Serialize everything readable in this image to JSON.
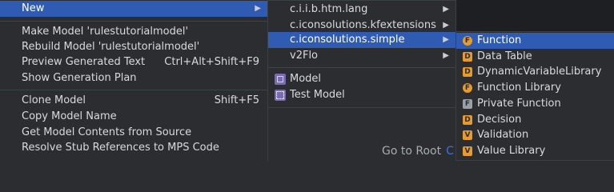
{
  "menu1": {
    "new_label": "New",
    "items": [
      {
        "label": "Make Model 'rulestutorialmodel'",
        "shortcut": ""
      },
      {
        "label": "Rebuild Model 'rulestutorialmodel'",
        "shortcut": ""
      },
      {
        "label": "Preview Generated Text",
        "shortcut": "Ctrl+Alt+Shift+F9"
      },
      {
        "label": "Show Generation Plan",
        "shortcut": ""
      },
      {
        "label": "Clone Model",
        "shortcut": "Shift+F5"
      },
      {
        "label": "Copy Model Name",
        "shortcut": ""
      },
      {
        "label": "Get Model Contents from Source",
        "shortcut": ""
      },
      {
        "label": "Resolve Stub References to MPS Code",
        "shortcut": ""
      }
    ]
  },
  "menu2": {
    "items": [
      {
        "label": "c.i.i.b.htm.lang"
      },
      {
        "label": "c.iconsolutions.kfextensions"
      },
      {
        "label": "c.iconsolutions.simple"
      },
      {
        "label": "v2Flo"
      },
      {
        "label": "Model",
        "icon": "model-icon"
      },
      {
        "label": "Test Model",
        "icon": "test-model-icon"
      }
    ]
  },
  "menu3": {
    "items": [
      {
        "label": "Function",
        "icon_letter": "F",
        "icon": "concept-function-icon"
      },
      {
        "label": "Data Table",
        "icon_letter": "D",
        "icon": "concept-data-table-icon"
      },
      {
        "label": "DynamicVariableLibrary",
        "icon_letter": "D",
        "icon": "concept-dynamic-variable-library-icon"
      },
      {
        "label": "Function Library",
        "icon_letter": "F",
        "icon": "concept-function-library-icon"
      },
      {
        "label": "Private Function",
        "icon_letter": "F",
        "icon": "concept-private-function-icon"
      },
      {
        "label": "Decision",
        "icon_letter": "D",
        "icon": "concept-decision-icon"
      },
      {
        "label": "Validation",
        "icon_letter": "V",
        "icon": "concept-validation-icon"
      },
      {
        "label": "Value Library",
        "icon_letter": "V",
        "icon": "concept-value-library-icon"
      }
    ]
  },
  "background": {
    "goto_root_label": "Go to Root",
    "goto_root_key": "C"
  },
  "colors": {
    "selection": "#2f5bb3",
    "menu_bg": "#2b2d30",
    "concept_icon": "#e89b2b",
    "model_icon": "#7a6bb6"
  }
}
